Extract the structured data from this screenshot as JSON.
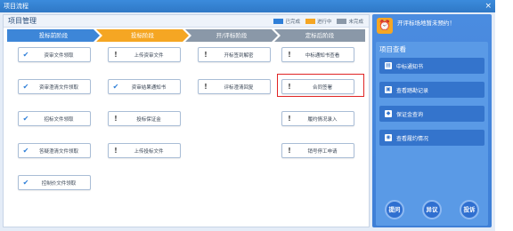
{
  "window": {
    "title": "项目流程",
    "close": "×"
  },
  "main": {
    "title": "项目管理",
    "legend": [
      {
        "label": "已完成",
        "color": "#2f7fd8"
      },
      {
        "label": "进行中",
        "color": "#f5a623"
      },
      {
        "label": "未完成",
        "color": "#8a98a8"
      }
    ],
    "steps": [
      {
        "label": "投标前阶段",
        "color": "#3d86d8"
      },
      {
        "label": "投标阶段",
        "color": "#f5a623"
      },
      {
        "label": "开/评标阶段",
        "color": "#8a98a8"
      },
      {
        "label": "定标后阶段",
        "color": "#8a98a8"
      }
    ],
    "tasks": [
      {
        "label": "资审文件领取",
        "status": "done"
      },
      {
        "label": "上传资审文件",
        "status": "todo"
      },
      {
        "label": "开标签到解密",
        "status": "todo"
      },
      {
        "label": "中标通知书查看",
        "status": "todo"
      },
      {
        "label": "资审澄清文件领取",
        "status": "done"
      },
      {
        "label": "资审结果通知书",
        "status": "done"
      },
      {
        "label": "评标澄清回复",
        "status": "todo"
      },
      {
        "label": "合同签署",
        "status": "todo"
      },
      {
        "label": "招标文件领取",
        "status": "done"
      },
      {
        "label": "投标保证金",
        "status": "todo"
      },
      {
        "label": "履约情况录入",
        "status": "todo"
      },
      {
        "label": "答疑澄清文件领取",
        "status": "done"
      },
      {
        "label": "上传投标文件",
        "status": "todo"
      },
      {
        "label": "销号停工申请",
        "status": "todo"
      },
      {
        "label": "控制价文件领取",
        "status": "done"
      }
    ],
    "icons": {
      "done": "✔",
      "todo": "!"
    }
  },
  "side": {
    "notice": "开评标场地暂未预约！",
    "section_title": "项目查看",
    "buttons": [
      {
        "label": "中标通知书",
        "icon": "document-icon"
      },
      {
        "label": "查看踏勘记录",
        "icon": "id-card-icon"
      },
      {
        "label": "保证金查询",
        "icon": "shield-icon"
      },
      {
        "label": "查看履约情况",
        "icon": "eye-icon"
      }
    ],
    "actions": [
      "提问",
      "异议",
      "投诉"
    ]
  }
}
